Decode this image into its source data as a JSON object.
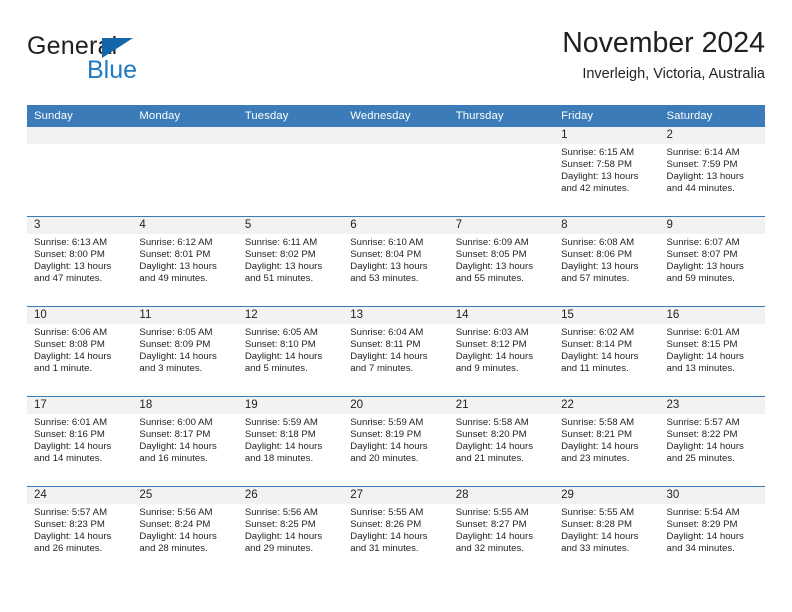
{
  "brand": {
    "name_part1": "General",
    "name_part2": "Blue",
    "logo_icon": "triangle-logo-icon"
  },
  "header": {
    "title": "November 2024",
    "subtitle": "Inverleigh, Victoria, Australia"
  },
  "colors": {
    "header_blue": "#3b7cb8",
    "brand_blue": "#1f7ac0",
    "logo_blue": "#1566a8",
    "daynum_band": "#f2f2f2",
    "text": "#231f20"
  },
  "weekday_headers": [
    "Sunday",
    "Monday",
    "Tuesday",
    "Wednesday",
    "Thursday",
    "Friday",
    "Saturday"
  ],
  "weeks": [
    [
      {
        "day": "",
        "sunrise": "",
        "sunset": "",
        "daylight_line1": "",
        "daylight_line2": "",
        "empty": true
      },
      {
        "day": "",
        "sunrise": "",
        "sunset": "",
        "daylight_line1": "",
        "daylight_line2": "",
        "empty": true
      },
      {
        "day": "",
        "sunrise": "",
        "sunset": "",
        "daylight_line1": "",
        "daylight_line2": "",
        "empty": true
      },
      {
        "day": "",
        "sunrise": "",
        "sunset": "",
        "daylight_line1": "",
        "daylight_line2": "",
        "empty": true
      },
      {
        "day": "",
        "sunrise": "",
        "sunset": "",
        "daylight_line1": "",
        "daylight_line2": "",
        "empty": true
      },
      {
        "day": "1",
        "sunrise": "Sunrise: 6:15 AM",
        "sunset": "Sunset: 7:58 PM",
        "daylight_line1": "Daylight: 13 hours",
        "daylight_line2": "and 42 minutes.",
        "empty": false
      },
      {
        "day": "2",
        "sunrise": "Sunrise: 6:14 AM",
        "sunset": "Sunset: 7:59 PM",
        "daylight_line1": "Daylight: 13 hours",
        "daylight_line2": "and 44 minutes.",
        "empty": false
      }
    ],
    [
      {
        "day": "3",
        "sunrise": "Sunrise: 6:13 AM",
        "sunset": "Sunset: 8:00 PM",
        "daylight_line1": "Daylight: 13 hours",
        "daylight_line2": "and 47 minutes.",
        "empty": false
      },
      {
        "day": "4",
        "sunrise": "Sunrise: 6:12 AM",
        "sunset": "Sunset: 8:01 PM",
        "daylight_line1": "Daylight: 13 hours",
        "daylight_line2": "and 49 minutes.",
        "empty": false
      },
      {
        "day": "5",
        "sunrise": "Sunrise: 6:11 AM",
        "sunset": "Sunset: 8:02 PM",
        "daylight_line1": "Daylight: 13 hours",
        "daylight_line2": "and 51 minutes.",
        "empty": false
      },
      {
        "day": "6",
        "sunrise": "Sunrise: 6:10 AM",
        "sunset": "Sunset: 8:04 PM",
        "daylight_line1": "Daylight: 13 hours",
        "daylight_line2": "and 53 minutes.",
        "empty": false
      },
      {
        "day": "7",
        "sunrise": "Sunrise: 6:09 AM",
        "sunset": "Sunset: 8:05 PM",
        "daylight_line1": "Daylight: 13 hours",
        "daylight_line2": "and 55 minutes.",
        "empty": false
      },
      {
        "day": "8",
        "sunrise": "Sunrise: 6:08 AM",
        "sunset": "Sunset: 8:06 PM",
        "daylight_line1": "Daylight: 13 hours",
        "daylight_line2": "and 57 minutes.",
        "empty": false
      },
      {
        "day": "9",
        "sunrise": "Sunrise: 6:07 AM",
        "sunset": "Sunset: 8:07 PM",
        "daylight_line1": "Daylight: 13 hours",
        "daylight_line2": "and 59 minutes.",
        "empty": false
      }
    ],
    [
      {
        "day": "10",
        "sunrise": "Sunrise: 6:06 AM",
        "sunset": "Sunset: 8:08 PM",
        "daylight_line1": "Daylight: 14 hours",
        "daylight_line2": "and 1 minute.",
        "empty": false
      },
      {
        "day": "11",
        "sunrise": "Sunrise: 6:05 AM",
        "sunset": "Sunset: 8:09 PM",
        "daylight_line1": "Daylight: 14 hours",
        "daylight_line2": "and 3 minutes.",
        "empty": false
      },
      {
        "day": "12",
        "sunrise": "Sunrise: 6:05 AM",
        "sunset": "Sunset: 8:10 PM",
        "daylight_line1": "Daylight: 14 hours",
        "daylight_line2": "and 5 minutes.",
        "empty": false
      },
      {
        "day": "13",
        "sunrise": "Sunrise: 6:04 AM",
        "sunset": "Sunset: 8:11 PM",
        "daylight_line1": "Daylight: 14 hours",
        "daylight_line2": "and 7 minutes.",
        "empty": false
      },
      {
        "day": "14",
        "sunrise": "Sunrise: 6:03 AM",
        "sunset": "Sunset: 8:12 PM",
        "daylight_line1": "Daylight: 14 hours",
        "daylight_line2": "and 9 minutes.",
        "empty": false
      },
      {
        "day": "15",
        "sunrise": "Sunrise: 6:02 AM",
        "sunset": "Sunset: 8:14 PM",
        "daylight_line1": "Daylight: 14 hours",
        "daylight_line2": "and 11 minutes.",
        "empty": false
      },
      {
        "day": "16",
        "sunrise": "Sunrise: 6:01 AM",
        "sunset": "Sunset: 8:15 PM",
        "daylight_line1": "Daylight: 14 hours",
        "daylight_line2": "and 13 minutes.",
        "empty": false
      }
    ],
    [
      {
        "day": "17",
        "sunrise": "Sunrise: 6:01 AM",
        "sunset": "Sunset: 8:16 PM",
        "daylight_line1": "Daylight: 14 hours",
        "daylight_line2": "and 14 minutes.",
        "empty": false
      },
      {
        "day": "18",
        "sunrise": "Sunrise: 6:00 AM",
        "sunset": "Sunset: 8:17 PM",
        "daylight_line1": "Daylight: 14 hours",
        "daylight_line2": "and 16 minutes.",
        "empty": false
      },
      {
        "day": "19",
        "sunrise": "Sunrise: 5:59 AM",
        "sunset": "Sunset: 8:18 PM",
        "daylight_line1": "Daylight: 14 hours",
        "daylight_line2": "and 18 minutes.",
        "empty": false
      },
      {
        "day": "20",
        "sunrise": "Sunrise: 5:59 AM",
        "sunset": "Sunset: 8:19 PM",
        "daylight_line1": "Daylight: 14 hours",
        "daylight_line2": "and 20 minutes.",
        "empty": false
      },
      {
        "day": "21",
        "sunrise": "Sunrise: 5:58 AM",
        "sunset": "Sunset: 8:20 PM",
        "daylight_line1": "Daylight: 14 hours",
        "daylight_line2": "and 21 minutes.",
        "empty": false
      },
      {
        "day": "22",
        "sunrise": "Sunrise: 5:58 AM",
        "sunset": "Sunset: 8:21 PM",
        "daylight_line1": "Daylight: 14 hours",
        "daylight_line2": "and 23 minutes.",
        "empty": false
      },
      {
        "day": "23",
        "sunrise": "Sunrise: 5:57 AM",
        "sunset": "Sunset: 8:22 PM",
        "daylight_line1": "Daylight: 14 hours",
        "daylight_line2": "and 25 minutes.",
        "empty": false
      }
    ],
    [
      {
        "day": "24",
        "sunrise": "Sunrise: 5:57 AM",
        "sunset": "Sunset: 8:23 PM",
        "daylight_line1": "Daylight: 14 hours",
        "daylight_line2": "and 26 minutes.",
        "empty": false
      },
      {
        "day": "25",
        "sunrise": "Sunrise: 5:56 AM",
        "sunset": "Sunset: 8:24 PM",
        "daylight_line1": "Daylight: 14 hours",
        "daylight_line2": "and 28 minutes.",
        "empty": false
      },
      {
        "day": "26",
        "sunrise": "Sunrise: 5:56 AM",
        "sunset": "Sunset: 8:25 PM",
        "daylight_line1": "Daylight: 14 hours",
        "daylight_line2": "and 29 minutes.",
        "empty": false
      },
      {
        "day": "27",
        "sunrise": "Sunrise: 5:55 AM",
        "sunset": "Sunset: 8:26 PM",
        "daylight_line1": "Daylight: 14 hours",
        "daylight_line2": "and 31 minutes.",
        "empty": false
      },
      {
        "day": "28",
        "sunrise": "Sunrise: 5:55 AM",
        "sunset": "Sunset: 8:27 PM",
        "daylight_line1": "Daylight: 14 hours",
        "daylight_line2": "and 32 minutes.",
        "empty": false
      },
      {
        "day": "29",
        "sunrise": "Sunrise: 5:55 AM",
        "sunset": "Sunset: 8:28 PM",
        "daylight_line1": "Daylight: 14 hours",
        "daylight_line2": "and 33 minutes.",
        "empty": false
      },
      {
        "day": "30",
        "sunrise": "Sunrise: 5:54 AM",
        "sunset": "Sunset: 8:29 PM",
        "daylight_line1": "Daylight: 14 hours",
        "daylight_line2": "and 34 minutes.",
        "empty": false
      }
    ]
  ]
}
